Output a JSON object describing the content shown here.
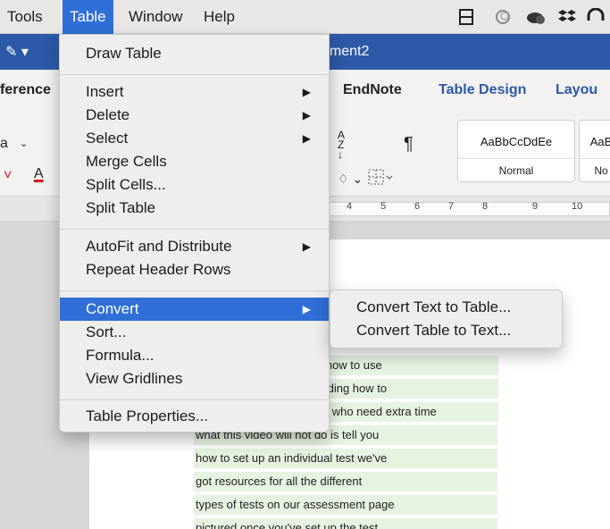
{
  "menubar": {
    "items": [
      "Tools",
      "Table",
      "Window",
      "Help"
    ],
    "active": "Table",
    "icons": [
      "filmstrip-icon",
      "crescent-icon",
      "cloud-sync-icon",
      "dropbox-icon",
      "headphones-icon"
    ]
  },
  "titlebar": {
    "doc_title": "ument2",
    "left_glyphs": "✎ ▾"
  },
  "ribbon_tabs": [
    "ference",
    "EndNote",
    "Table Design",
    "Layou"
  ],
  "ribbon": {
    "font_dropdown": "a",
    "font_color_letter": "A",
    "sort_label": "A Z ↓",
    "pilcrow": "¶",
    "styles": [
      {
        "sample": "AaBbCcDdEe",
        "name": "Normal"
      },
      {
        "sample": "AaB",
        "name": "No"
      }
    ]
  },
  "ruler": {
    "numbers": [
      "4",
      "5",
      "6",
      "7",
      "8",
      "9",
      "10"
    ]
  },
  "table_menu": {
    "items": [
      {
        "label": "Draw Table",
        "submenu": false
      },
      {
        "label": "Insert",
        "submenu": true
      },
      {
        "label": "Delete",
        "submenu": true
      },
      {
        "label": "Select",
        "submenu": true
      },
      {
        "label": "Merge Cells",
        "submenu": false
      },
      {
        "label": "Split Cells...",
        "submenu": false
      },
      {
        "label": "Split Table",
        "submenu": false
      },
      {
        "label": "AutoFit and Distribute",
        "submenu": true
      },
      {
        "label": "Repeat Header Rows",
        "submenu": false
      },
      {
        "label": "Convert",
        "submenu": true,
        "highlighted": true
      },
      {
        "label": "Sort...",
        "submenu": false
      },
      {
        "label": "Formula...",
        "submenu": false
      },
      {
        "label": "View Gridlines",
        "submenu": false
      },
      {
        "label": "Table Properties...",
        "submenu": false
      }
    ]
  },
  "convert_submenu": {
    "items": [
      "Convert Text to Table...",
      "Convert Table to Text..."
    ]
  },
  "document": {
    "lines": [
      "u how to use",
      "cluding how to",
      "ts who need extra time",
      "what this video will not do is tell you",
      "how to set up an individual test we've",
      "got resources for all the different",
      "types of tests on our assessment page",
      "pictured once you've set up the test"
    ]
  }
}
